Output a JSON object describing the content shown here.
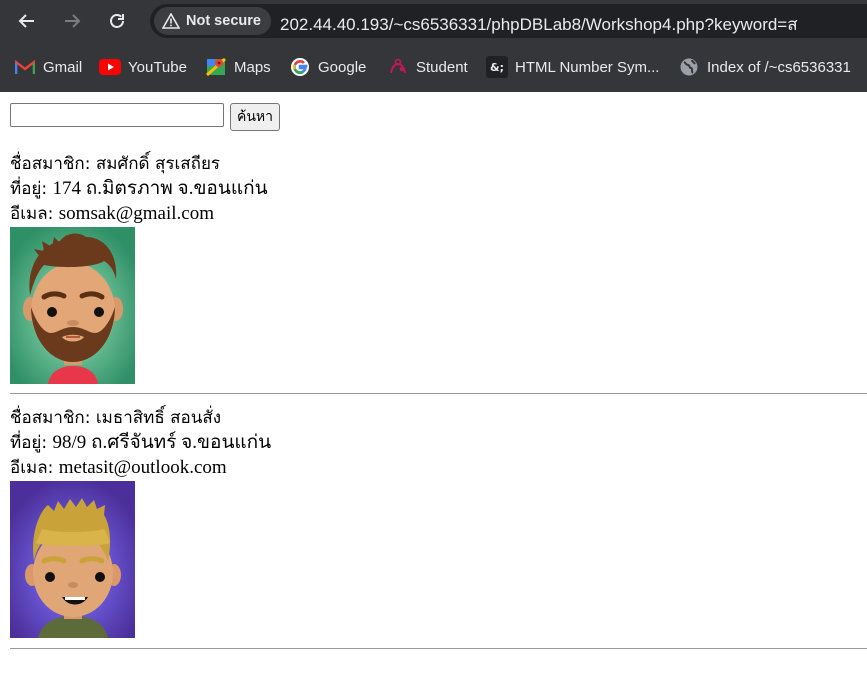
{
  "browser": {
    "security_label": "Not secure",
    "url": "202.44.40.193/~cs6536331/phpDBLab8/Workshop4.php?keyword=ส",
    "bookmarks": [
      {
        "label": "Gmail",
        "icon": "gmail-icon"
      },
      {
        "label": "YouTube",
        "icon": "youtube-icon"
      },
      {
        "label": "Maps",
        "icon": "maps-icon"
      },
      {
        "label": "Google",
        "icon": "google-icon"
      },
      {
        "label": "Student",
        "icon": "student-icon"
      },
      {
        "label": "HTML Number Sym...",
        "icon": "ampersand-icon"
      },
      {
        "label": "Index of /~cs6536331",
        "icon": "globe-icon"
      }
    ]
  },
  "search": {
    "value": "",
    "button_label": "ค้นหา"
  },
  "members": [
    {
      "name_label": "ชื่อสมาชิก: ",
      "name": "สมศักดิ์ สุรเสถียร",
      "address_label": "ที่อยู่: ",
      "address": "174 ถ.มิตรภาพ จ.ขอนแก่น",
      "email_label": "อีเมล: ",
      "email": "somsak@gmail.com",
      "avatar_bg": "#3a9a70",
      "avatar": "bearded-man-avatar"
    },
    {
      "name_label": "ชื่อสมาชิก: ",
      "name": "เมธาสิทธิ์ สอนสั่ง",
      "address_label": "ที่อยู่: ",
      "address": "98/9 ถ.ศรีจันทร์ จ.ขอนแก่น",
      "email_label": "อีเมล: ",
      "email": "metasit@outlook.com",
      "avatar_bg": "#5a3fa3",
      "avatar": "blond-man-avatar"
    }
  ]
}
